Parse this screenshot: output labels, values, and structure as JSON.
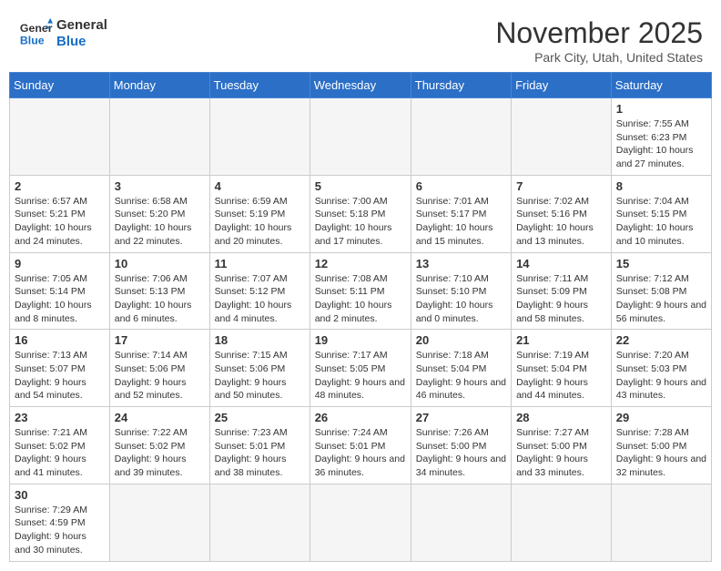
{
  "header": {
    "logo_general": "General",
    "logo_blue": "Blue",
    "month_title": "November 2025",
    "location": "Park City, Utah, United States"
  },
  "weekdays": [
    "Sunday",
    "Monday",
    "Tuesday",
    "Wednesday",
    "Thursday",
    "Friday",
    "Saturday"
  ],
  "weeks": [
    [
      {
        "day": "",
        "info": ""
      },
      {
        "day": "",
        "info": ""
      },
      {
        "day": "",
        "info": ""
      },
      {
        "day": "",
        "info": ""
      },
      {
        "day": "",
        "info": ""
      },
      {
        "day": "",
        "info": ""
      },
      {
        "day": "1",
        "info": "Sunrise: 7:55 AM\nSunset: 6:23 PM\nDaylight: 10 hours and 27 minutes."
      }
    ],
    [
      {
        "day": "2",
        "info": "Sunrise: 6:57 AM\nSunset: 5:21 PM\nDaylight: 10 hours and 24 minutes."
      },
      {
        "day": "3",
        "info": "Sunrise: 6:58 AM\nSunset: 5:20 PM\nDaylight: 10 hours and 22 minutes."
      },
      {
        "day": "4",
        "info": "Sunrise: 6:59 AM\nSunset: 5:19 PM\nDaylight: 10 hours and 20 minutes."
      },
      {
        "day": "5",
        "info": "Sunrise: 7:00 AM\nSunset: 5:18 PM\nDaylight: 10 hours and 17 minutes."
      },
      {
        "day": "6",
        "info": "Sunrise: 7:01 AM\nSunset: 5:17 PM\nDaylight: 10 hours and 15 minutes."
      },
      {
        "day": "7",
        "info": "Sunrise: 7:02 AM\nSunset: 5:16 PM\nDaylight: 10 hours and 13 minutes."
      },
      {
        "day": "8",
        "info": "Sunrise: 7:04 AM\nSunset: 5:15 PM\nDaylight: 10 hours and 10 minutes."
      }
    ],
    [
      {
        "day": "9",
        "info": "Sunrise: 7:05 AM\nSunset: 5:14 PM\nDaylight: 10 hours and 8 minutes."
      },
      {
        "day": "10",
        "info": "Sunrise: 7:06 AM\nSunset: 5:13 PM\nDaylight: 10 hours and 6 minutes."
      },
      {
        "day": "11",
        "info": "Sunrise: 7:07 AM\nSunset: 5:12 PM\nDaylight: 10 hours and 4 minutes."
      },
      {
        "day": "12",
        "info": "Sunrise: 7:08 AM\nSunset: 5:11 PM\nDaylight: 10 hours and 2 minutes."
      },
      {
        "day": "13",
        "info": "Sunrise: 7:10 AM\nSunset: 5:10 PM\nDaylight: 10 hours and 0 minutes."
      },
      {
        "day": "14",
        "info": "Sunrise: 7:11 AM\nSunset: 5:09 PM\nDaylight: 9 hours and 58 minutes."
      },
      {
        "day": "15",
        "info": "Sunrise: 7:12 AM\nSunset: 5:08 PM\nDaylight: 9 hours and 56 minutes."
      }
    ],
    [
      {
        "day": "16",
        "info": "Sunrise: 7:13 AM\nSunset: 5:07 PM\nDaylight: 9 hours and 54 minutes."
      },
      {
        "day": "17",
        "info": "Sunrise: 7:14 AM\nSunset: 5:06 PM\nDaylight: 9 hours and 52 minutes."
      },
      {
        "day": "18",
        "info": "Sunrise: 7:15 AM\nSunset: 5:06 PM\nDaylight: 9 hours and 50 minutes."
      },
      {
        "day": "19",
        "info": "Sunrise: 7:17 AM\nSunset: 5:05 PM\nDaylight: 9 hours and 48 minutes."
      },
      {
        "day": "20",
        "info": "Sunrise: 7:18 AM\nSunset: 5:04 PM\nDaylight: 9 hours and 46 minutes."
      },
      {
        "day": "21",
        "info": "Sunrise: 7:19 AM\nSunset: 5:04 PM\nDaylight: 9 hours and 44 minutes."
      },
      {
        "day": "22",
        "info": "Sunrise: 7:20 AM\nSunset: 5:03 PM\nDaylight: 9 hours and 43 minutes."
      }
    ],
    [
      {
        "day": "23",
        "info": "Sunrise: 7:21 AM\nSunset: 5:02 PM\nDaylight: 9 hours and 41 minutes."
      },
      {
        "day": "24",
        "info": "Sunrise: 7:22 AM\nSunset: 5:02 PM\nDaylight: 9 hours and 39 minutes."
      },
      {
        "day": "25",
        "info": "Sunrise: 7:23 AM\nSunset: 5:01 PM\nDaylight: 9 hours and 38 minutes."
      },
      {
        "day": "26",
        "info": "Sunrise: 7:24 AM\nSunset: 5:01 PM\nDaylight: 9 hours and 36 minutes."
      },
      {
        "day": "27",
        "info": "Sunrise: 7:26 AM\nSunset: 5:00 PM\nDaylight: 9 hours and 34 minutes."
      },
      {
        "day": "28",
        "info": "Sunrise: 7:27 AM\nSunset: 5:00 PM\nDaylight: 9 hours and 33 minutes."
      },
      {
        "day": "29",
        "info": "Sunrise: 7:28 AM\nSunset: 5:00 PM\nDaylight: 9 hours and 32 minutes."
      }
    ],
    [
      {
        "day": "30",
        "info": "Sunrise: 7:29 AM\nSunset: 4:59 PM\nDaylight: 9 hours and 30 minutes."
      },
      {
        "day": "",
        "info": ""
      },
      {
        "day": "",
        "info": ""
      },
      {
        "day": "",
        "info": ""
      },
      {
        "day": "",
        "info": ""
      },
      {
        "day": "",
        "info": ""
      },
      {
        "day": "",
        "info": ""
      }
    ]
  ]
}
